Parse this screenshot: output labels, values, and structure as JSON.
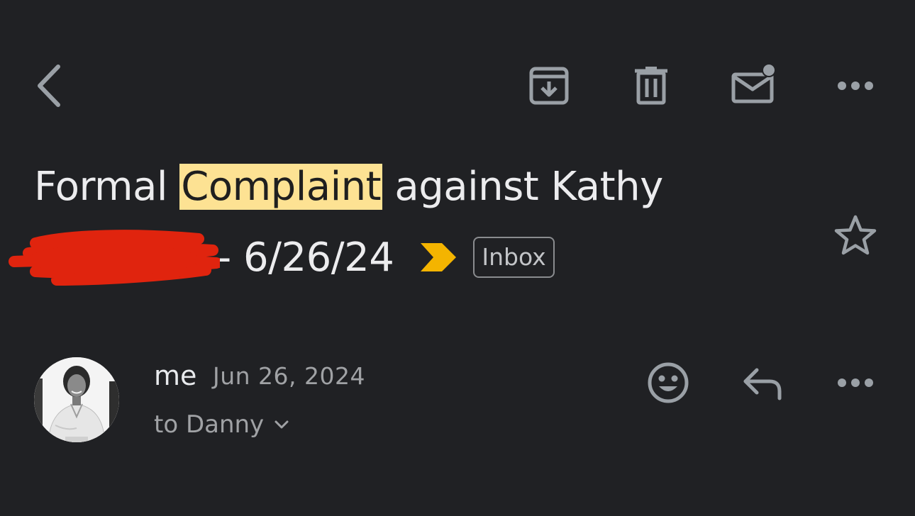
{
  "toolbar": {
    "back_icon": "back-arrow-icon",
    "archive_icon": "archive-icon",
    "delete_icon": "trash-icon",
    "mark_unread_icon": "mark-unread-icon",
    "more_icon": "more-horizontal-icon"
  },
  "subject": {
    "prefix": "Formal ",
    "highlighted": "Complaint",
    "suffix": " against Kathy",
    "line2_tail": "- 6/26/24",
    "importance_marker": "importance-marker-icon",
    "label": "Inbox",
    "star_icon": "star-outline-icon"
  },
  "message": {
    "sender": "me",
    "date": "Jun 26, 2024",
    "recipient": "to Danny",
    "emoji_icon": "add-reaction-icon",
    "reply_icon": "reply-icon",
    "more_icon": "more-horizontal-icon"
  },
  "colors": {
    "background": "#202124",
    "highlight": "#fde293",
    "importance": "#f4b400",
    "redaction": "#e0240e",
    "icon": "#9aa0a6"
  }
}
